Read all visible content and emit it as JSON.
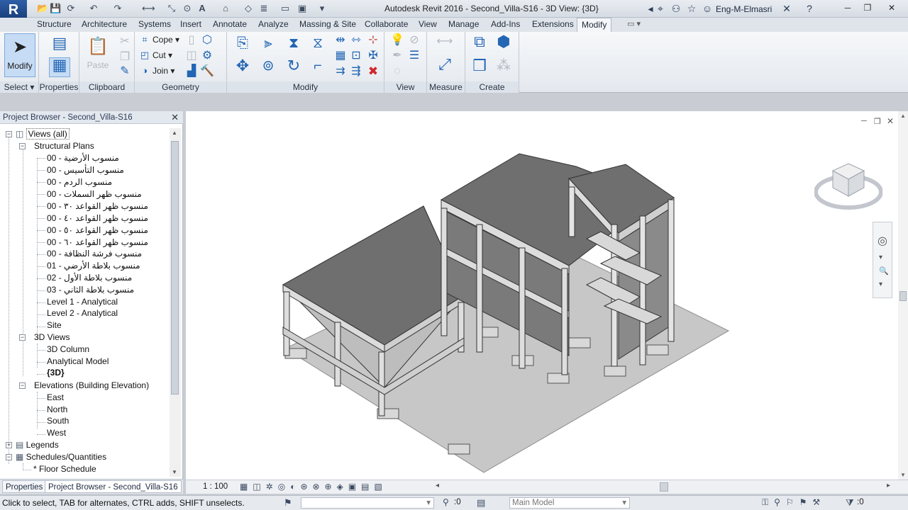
{
  "window": {
    "title": "Autodesk Revit 2016 -    Second_Villa-S16 - 3D View: {3D}",
    "user": "Eng-M-Elmasri",
    "app_logo": "R"
  },
  "ribbon_tabs": [
    {
      "label": "Structure"
    },
    {
      "label": "Architecture"
    },
    {
      "label": "Systems"
    },
    {
      "label": "Insert"
    },
    {
      "label": "Annotate"
    },
    {
      "label": "Analyze"
    },
    {
      "label": "Massing & Site"
    },
    {
      "label": "Collaborate"
    },
    {
      "label": "View"
    },
    {
      "label": "Manage"
    },
    {
      "label": "Add-Ins"
    },
    {
      "label": "Extensions"
    },
    {
      "label": "Modify"
    }
  ],
  "ribbon": {
    "select": {
      "modify_label": "Modify",
      "panel_label": "Select ▾"
    },
    "properties": {
      "panel_label": "Properties"
    },
    "clipboard": {
      "paste_label": "Paste",
      "panel_label": "Clipboard"
    },
    "geometry": {
      "cope_label": "Cope",
      "cut_label": "Cut",
      "join_label": "Join",
      "panel_label": "Geometry"
    },
    "modify": {
      "panel_label": "Modify"
    },
    "view": {
      "panel_label": "View"
    },
    "measure": {
      "panel_label": "Measure"
    },
    "create": {
      "panel_label": "Create"
    }
  },
  "project_browser": {
    "title": "Project Browser - Second_Villa-S16",
    "tree": {
      "root": "Views (all)",
      "structural_plans": "Structural Plans",
      "plans": [
        "منسوب الأرضية - 00",
        "منسوب التأسيس - 00",
        "منسوب الردم - 00",
        "منسوب ظهر السملات - 00",
        "منسوب ظهر القواعد ٣٠ - 00",
        "منسوب ظهر القواعد ٤٠ - 00",
        "منسوب ظهر القواعد ٥٠ - 00",
        "منسوب ظهر القواعد ٦٠ - 00",
        "منسوب فرشة النظافة - 00",
        "منسوب بلاطة الأرضي - 01",
        "منسوب بلاطة الأول - 02",
        "منسوب بلاطة الثاني - 03",
        "Level 1 - Analytical",
        "Level 2 - Analytical",
        "Site"
      ],
      "views_3d": "3D Views",
      "views_3d_items": [
        "3D Column",
        "Analytical Model",
        "{3D}"
      ],
      "elevations": "Elevations (Building Elevation)",
      "elevation_items": [
        "East",
        "North",
        "South",
        "West"
      ],
      "legends": "Legends",
      "schedules": "Schedules/Quantities",
      "schedule_items": [
        "* Floor Schedule"
      ]
    },
    "tabs": [
      "Properties",
      "Project Browser - Second_Villa-S16"
    ]
  },
  "view_control": {
    "scale": "1 : 100"
  },
  "status": {
    "message": "Click to select, TAB for alternates, CTRL adds, SHIFT unselects.",
    "counter": ":0",
    "model": "Main Model",
    "filter_count": ":0"
  },
  "colors": {
    "accent": "#1b63b6",
    "slab": "#6f6f6f",
    "column": "#d9d9d9",
    "ground": "#c7c7c7"
  }
}
